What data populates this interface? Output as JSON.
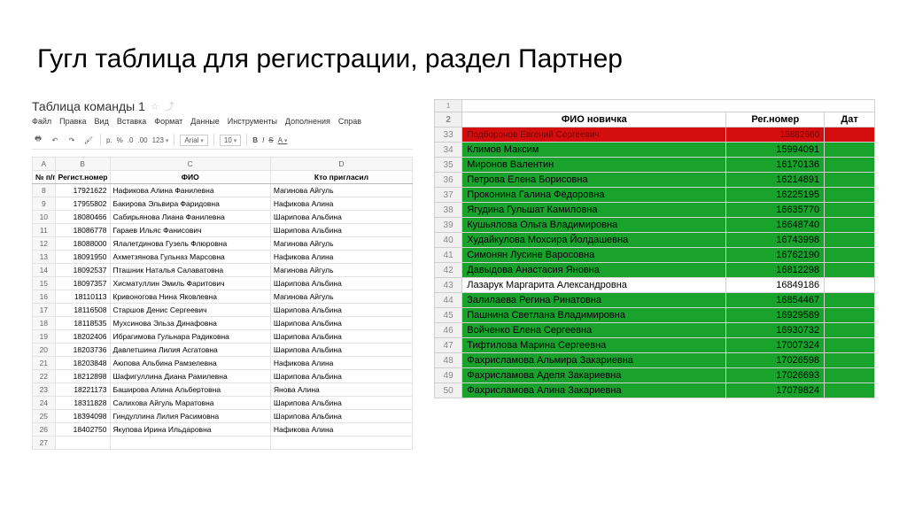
{
  "title": "Гугл таблица для регистрации, раздел Партнер",
  "left": {
    "doc_title": "Таблица команды 1",
    "menu": [
      "Файл",
      "Правка",
      "Вид",
      "Вставка",
      "Формат",
      "Данные",
      "Инструменты",
      "Дополнения",
      "Справ"
    ],
    "font": "Arial",
    "fontsize": "10",
    "col_letters": [
      "A",
      "B",
      "C",
      "D"
    ],
    "head": [
      "№ п/п",
      "Регист.номер",
      "ФИО",
      "Кто пригласил"
    ],
    "rows": [
      {
        "n": 8,
        "reg": 17921622,
        "fio": "Нафикова Алина Фанилевна",
        "who": "Магинова Айгуль"
      },
      {
        "n": 9,
        "reg": 17955802,
        "fio": "Бакирова Эльвира Фаридовна",
        "who": "Нафикова Алина"
      },
      {
        "n": 10,
        "reg": 18080466,
        "fio": "Сабирьянова Лиана Фанилевна",
        "who": "Шарипова Альбина"
      },
      {
        "n": 11,
        "reg": 18086778,
        "fio": "Гараев Ильяс Фанисович",
        "who": "Шарипова Альбина"
      },
      {
        "n": 12,
        "reg": 18088000,
        "fio": "Ялалетдинова Гузель Флюровна",
        "who": "Магинова Айгуль"
      },
      {
        "n": 13,
        "reg": 18091950,
        "fio": "Ахметзянова Гульназ Марсовна",
        "who": "Нафикова Алина"
      },
      {
        "n": 14,
        "reg": 18092537,
        "fio": "Пташник Наталья Салаватовна",
        "who": "Магинова Айгуль"
      },
      {
        "n": 15,
        "reg": 18097357,
        "fio": "Хисматуллин Эмиль Фаритович",
        "who": "Шарипова Альбина"
      },
      {
        "n": 16,
        "reg": 18110113,
        "fio": "Кривоногова Нина Яковлевна",
        "who": "Магинова Айгуль"
      },
      {
        "n": 17,
        "reg": 18116508,
        "fio": "Старшов Денис Сергеевич",
        "who": "Шарипова Альбина"
      },
      {
        "n": 18,
        "reg": 18118535,
        "fio": "Мухсинова Эльза Динафовна",
        "who": "Шарипова Альбина"
      },
      {
        "n": 19,
        "reg": 18202406,
        "fio": "Ибрагимова Гульнара Радиковна",
        "who": "Шарипова Альбина"
      },
      {
        "n": 20,
        "reg": 18203736,
        "fio": "Давлетшина Лилия Асгатовна",
        "who": "Шарипова Альбина"
      },
      {
        "n": 21,
        "reg": 18203848,
        "fio": "Аюпова Альбина Рамзелевна",
        "who": "Нафикова Алина"
      },
      {
        "n": 22,
        "reg": 18212898,
        "fio": "Шафигуллина Диана Рамилевна",
        "who": "Шарипова Альбина"
      },
      {
        "n": 23,
        "reg": 18221173,
        "fio": "Баширова Алина Альбертовна",
        "who": "Янова Алина"
      },
      {
        "n": 24,
        "reg": 18311828,
        "fio": "Салихова Айгуль Маратовна",
        "who": "Шарипова Альбина"
      },
      {
        "n": 25,
        "reg": 18394098,
        "fio": "Гиндуллина Лилия Расимовна",
        "who": "Шарипова Альбина"
      },
      {
        "n": 26,
        "reg": 18402750,
        "fio": "Якупова Ирина Ильдаровна",
        "who": "Нафикова Алина"
      }
    ],
    "empty_row": 27
  },
  "right": {
    "head": [
      "ФИО новичка",
      "Рег.номер",
      "Дат"
    ],
    "first_row_label": 1,
    "header_row_label": 2,
    "rows": [
      {
        "rh": 33,
        "fio": "Подборонов Евгений Сергеевич",
        "reg": 15882660,
        "color": "red"
      },
      {
        "rh": 34,
        "fio": "Климов Максим",
        "reg": 15994091,
        "color": "green"
      },
      {
        "rh": 35,
        "fio": "Миронов Валентин",
        "reg": 16170136,
        "color": "green"
      },
      {
        "rh": 36,
        "fio": "Петрова Елена Борисовна",
        "reg": 16214891,
        "color": "green"
      },
      {
        "rh": 37,
        "fio": "Проконина Галина Фёдоровна",
        "reg": 16225195,
        "color": "green"
      },
      {
        "rh": 38,
        "fio": "Ягудина Гульшат Камиловна",
        "reg": 16635770,
        "color": "green"
      },
      {
        "rh": 39,
        "fio": "Кушьялова Ольга Владимировна",
        "reg": 16648740,
        "color": "green"
      },
      {
        "rh": 40,
        "fio": "Худайкулова Мохсира Йолдашевна",
        "reg": 16743998,
        "color": "green"
      },
      {
        "rh": 41,
        "fio": "Симонян Лусине Варосовна",
        "reg": 16762190,
        "color": "green"
      },
      {
        "rh": 42,
        "fio": "Давыдова Анастасия Яновна",
        "reg": 16812298,
        "color": "green"
      },
      {
        "rh": 43,
        "fio": "Лазарук Маргарита Александровна",
        "reg": 16849186,
        "color": "white"
      },
      {
        "rh": 44,
        "fio": "Залилаева Регина Ринатовна",
        "reg": 16854467,
        "color": "green"
      },
      {
        "rh": 45,
        "fio": "Пашнина Светлана Владимировна",
        "reg": 16929589,
        "color": "green"
      },
      {
        "rh": 46,
        "fio": "Войченко Елена Сергеевна",
        "reg": 16930732,
        "color": "green"
      },
      {
        "rh": 47,
        "fio": "Тифтилова Марина Сергеевна",
        "reg": 17007324,
        "color": "green"
      },
      {
        "rh": 48,
        "fio": "Фахрисламова Альмира  Закариевна",
        "reg": 17026598,
        "color": "green"
      },
      {
        "rh": 49,
        "fio": "Фахрисламова Аделя Закариевна",
        "reg": 17026693,
        "color": "green"
      },
      {
        "rh": 50,
        "fio": "Фахрисламова Алина Закариевна",
        "reg": 17079824,
        "color": "green"
      }
    ]
  }
}
